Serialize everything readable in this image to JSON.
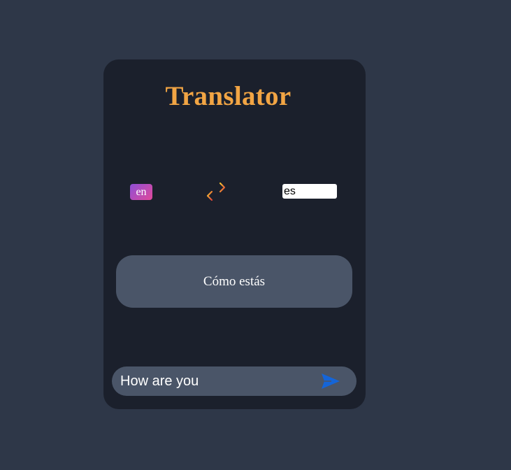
{
  "app": {
    "title": "Translator"
  },
  "languages": {
    "source": "en",
    "target": "es"
  },
  "output": {
    "translated_text": "Cómo estás"
  },
  "input": {
    "value": "How are you"
  },
  "icons": {
    "swap": "swap-arrows-icon",
    "send": "send-icon"
  },
  "colors": {
    "page_background": "#2e3748",
    "card_background": "#1b202c",
    "title": "#f2a544",
    "panel": "#4a5568",
    "send_icon": "#1565d8",
    "badge_gradient_start": "#8e4fd6",
    "badge_gradient_end": "#e0499a"
  }
}
